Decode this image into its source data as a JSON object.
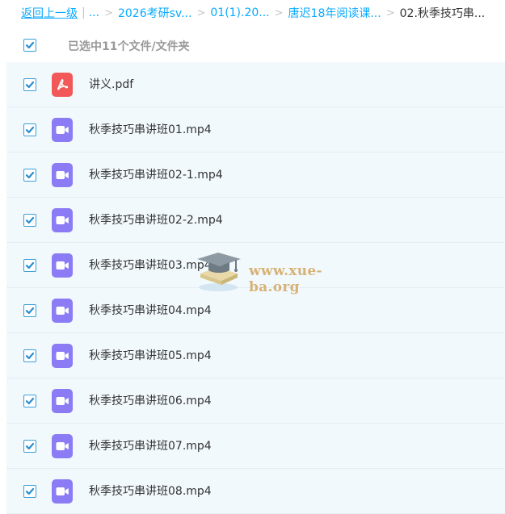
{
  "breadcrumb": {
    "back_label": "返回上一级",
    "divider": "|",
    "ellipsis": "...",
    "separator": ">",
    "items": [
      "2026考研sv...",
      "01(1).20...",
      "唐迟18年阅读课..."
    ],
    "current": "02.秋季技巧串..."
  },
  "selection": {
    "checked": true,
    "summary": "已选中11个文件/文件夹"
  },
  "files": [
    {
      "name": "讲义.pdf",
      "type": "pdf",
      "checked": true
    },
    {
      "name": "秋季技巧串讲班01.mp4",
      "type": "video",
      "checked": true
    },
    {
      "name": "秋季技巧串讲班02-1.mp4",
      "type": "video",
      "checked": true
    },
    {
      "name": "秋季技巧串讲班02-2.mp4",
      "type": "video",
      "checked": true
    },
    {
      "name": "秋季技巧串讲班03.mp4",
      "type": "video",
      "checked": true
    },
    {
      "name": "秋季技巧串讲班04.mp4",
      "type": "video",
      "checked": true
    },
    {
      "name": "秋季技巧串讲班05.mp4",
      "type": "video",
      "checked": true
    },
    {
      "name": "秋季技巧串讲班06.mp4",
      "type": "video",
      "checked": true
    },
    {
      "name": "秋季技巧串讲班07.mp4",
      "type": "video",
      "checked": true
    },
    {
      "name": "秋季技巧串讲班08.mp4",
      "type": "video",
      "checked": true
    }
  ],
  "watermark": {
    "text": "www.xue-ba.org"
  },
  "colors": {
    "link": "#09AAFF",
    "checkbox": "#2a8fd1",
    "pdf_icon": "#f25858",
    "video_icon": "#8b7cf6",
    "row_bg": "#f2f9fd"
  }
}
